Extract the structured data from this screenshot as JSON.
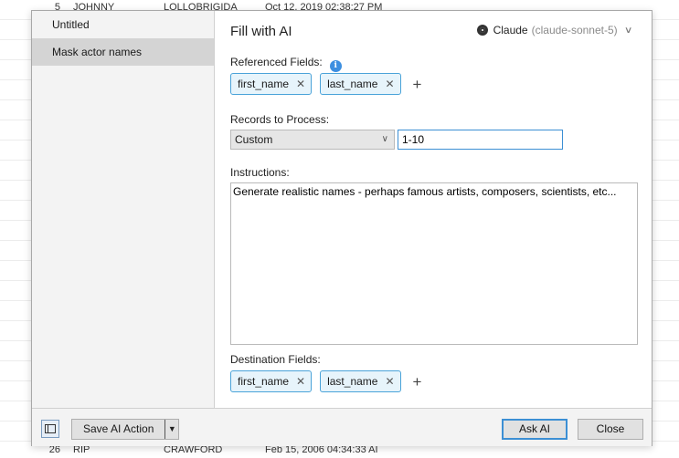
{
  "background_rows": [
    {
      "num": "5",
      "first": "JOHNNY",
      "last": "LOLLOBRIGIDA",
      "date": "Oct 12, 2019 02:38:27 PM"
    },
    {
      "num": "26",
      "first": "RIP",
      "last": "CRAWFORD",
      "date": "Feb 15, 2006 04:34:33 AI"
    }
  ],
  "sidebar": {
    "items": [
      {
        "label": "Untitled"
      },
      {
        "label": "Mask actor names"
      }
    ]
  },
  "dialog": {
    "title": "Fill with AI",
    "model": {
      "name": "Claude",
      "id": "(claude-sonnet-5)"
    },
    "referenced_fields_label": "Referenced Fields:",
    "referenced_fields": [
      "first_name",
      "last_name"
    ],
    "records_label": "Records to Process:",
    "records_mode": "Custom",
    "records_range": "1-10",
    "instructions_label": "Instructions:",
    "instructions_text": "Generate realistic names - perhaps famous artists, composers, scientists, etc...",
    "destination_fields_label": "Destination Fields:",
    "destination_fields": [
      "first_name",
      "last_name"
    ]
  },
  "footer": {
    "save_label": "Save AI Action",
    "ask_label": "Ask AI",
    "close_label": "Close"
  },
  "icons": {
    "info": "info-icon",
    "remove": "close-icon",
    "add": "plus-icon",
    "chevron": "chevron-down-icon",
    "model": "model-icon",
    "sidebar_toggle": "sidebar-toggle-icon"
  },
  "colors": {
    "chip_border": "#4aa3d9",
    "chip_bg": "#e7f4fb",
    "info_blue": "#3d8fe0",
    "focus_blue": "#3c8fd4"
  }
}
